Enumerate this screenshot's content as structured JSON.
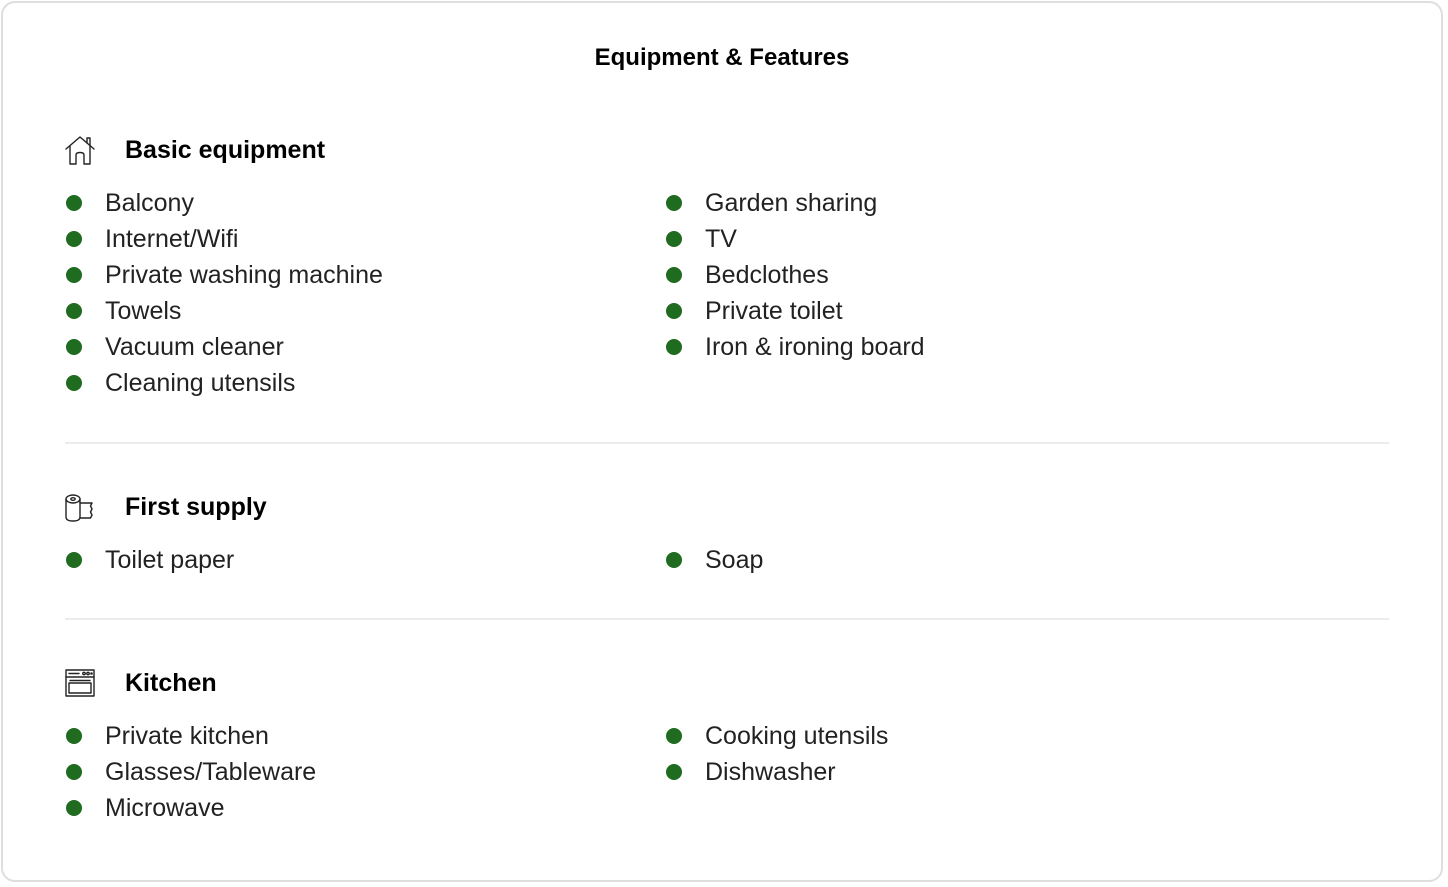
{
  "title": "Equipment & Features",
  "colors": {
    "bullet": "#1f6b1f",
    "divider": "#ececec",
    "border": "#dedede"
  },
  "sections": [
    {
      "icon": "house-icon",
      "title": "Basic equipment",
      "left": [
        "Balcony",
        "Internet/Wifi",
        "Private washing machine",
        "Towels",
        "Vacuum cleaner",
        "Cleaning utensils"
      ],
      "right": [
        "Garden sharing",
        "TV",
        "Bedclothes",
        "Private toilet",
        "Iron & ironing board"
      ]
    },
    {
      "icon": "paper-roll-icon",
      "title": "First supply",
      "left": [
        "Toilet paper"
      ],
      "right": [
        "Soap"
      ]
    },
    {
      "icon": "oven-icon",
      "title": "Kitchen",
      "left": [
        "Private kitchen",
        "Glasses/Tableware",
        "Microwave"
      ],
      "right": [
        "Cooking utensils",
        "Dishwasher"
      ]
    }
  ]
}
